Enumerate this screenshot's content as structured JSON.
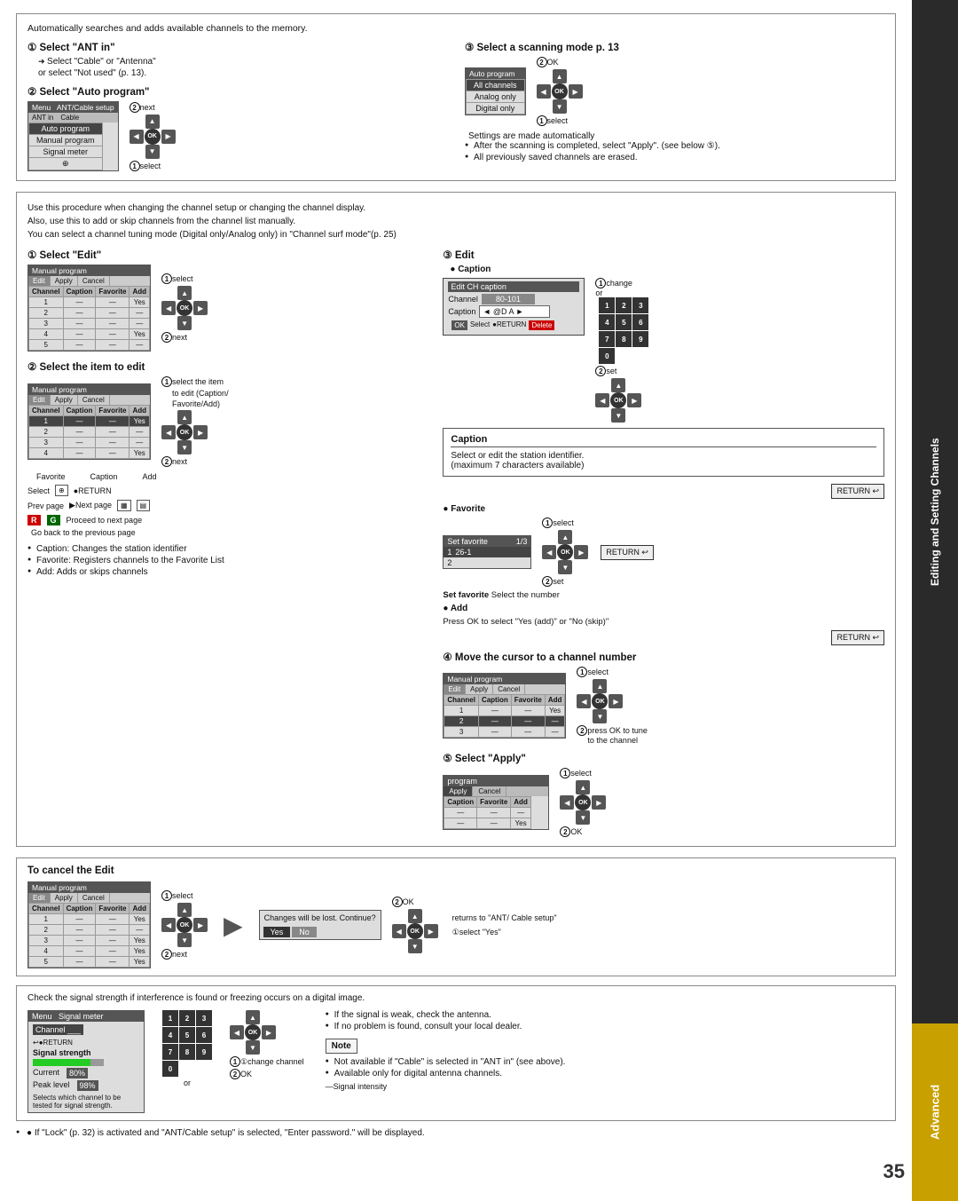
{
  "page": {
    "number": "35",
    "sidebar_editing": "Editing and Setting Channels",
    "sidebar_advanced": "Advanced"
  },
  "top_section": {
    "intro": "Automatically searches and adds available channels to the memory.",
    "step1_heading": "① Select \"ANT in\"",
    "step1_sub1": "Select \"Cable\" or \"Antenna\"",
    "step1_sub2": "or select \"Not used\" (p. 13).",
    "step2_heading": "② Select \"Auto program\"",
    "step3_heading": "③ Select a scanning mode p. 13",
    "note1": "After the scanning is completed, select \"Apply\".",
    "note2": "(see below ⑤).",
    "note3": "All previously saved channels are erased.",
    "settings_auto": "Settings are made automatically",
    "annotation_next": "②next",
    "annotation_select1": "①select",
    "annotation_ok": "②OK",
    "annotation_select2": "①select"
  },
  "menu_auto_program": {
    "header_col1": "Menu",
    "header_col2": "ANT/Cable setup",
    "header_sub1": "ANT in",
    "header_sub2": "Cable",
    "rows": [
      {
        "label": "Auto program",
        "highlight": true
      },
      {
        "label": "Manual program",
        "highlight": false
      },
      {
        "label": "Signal meter",
        "highlight": false
      }
    ]
  },
  "menu_auto_program2": {
    "header": "Auto program",
    "rows": [
      {
        "label": "All channels",
        "highlight": true
      },
      {
        "label": "Analog only",
        "highlight": false
      },
      {
        "label": "Digital only",
        "highlight": false
      }
    ]
  },
  "middle_section": {
    "intro_lines": [
      "Use this procedure when changing the channel setup or changing the channel display.",
      "Also, use this to add or skip channels from the channel list manually.",
      "You can select a channel tuning mode (Digital only/Analog only) in \"Channel surf mode\"(p. 25)"
    ],
    "step1_heading": "① Select \"Edit\"",
    "step2_heading": "② Select the item to edit",
    "step2_items": [
      "Caption: Changes the station identifier",
      "Favorite: Registers channels to the Favorite List",
      "Add: Adds or skips channels"
    ],
    "proceed_next_page": "Proceed to next page",
    "go_back": "Go back to the previous page",
    "step3_edit_heading": "③ Edit",
    "step3_caption_heading": "● Caption",
    "caption_desc": "Select or edit the station identifier.",
    "caption_max": "(maximum 7 characters available)",
    "step3_favorite_heading": "● Favorite",
    "step4_move_heading": "④ Move the cursor to a channel number",
    "step5_apply_heading": "⑤ Select \"Apply\"",
    "add_heading": "● Add",
    "add_desc": "Press OK to select \"Yes (add)\" or \"No (skip)\"",
    "set_favorite_label": "Set favorite",
    "set_favorite_desc": "Select the number",
    "annotations": {
      "select": "①select",
      "next": "②next",
      "change": "①change",
      "set": "②set",
      "ok": "②OK",
      "press_ok": "②press OK to tune to the channel"
    }
  },
  "cancel_section": {
    "heading": "To cancel the Edit",
    "annotations": {
      "select": "①select",
      "next": "②next",
      "ok": "②OK",
      "returns": "returns to \"ANT/ Cable setup\"",
      "select_yes": "①select \"Yes\""
    },
    "dialog": {
      "msg": "Changes will be lost. Continue?",
      "btn_yes": "Yes",
      "btn_no": "No"
    }
  },
  "signal_section": {
    "intro": "Check the signal strength if interference is found or freezing occurs on a digital image.",
    "note1": "If the signal is weak, check the antenna.",
    "note2": "If no problem is found, consult your local dealer.",
    "annotations": {
      "change_channel": "①change channel",
      "ok": "②OK"
    },
    "note_label": "Note",
    "note3": "Not available if \"Cable\" is selected in \"ANT in\" (see above).",
    "note4": "Available only for digital antenna channels.",
    "signal_intensity_label": "Signal intensity",
    "menu_signal": {
      "header": "Menu",
      "sub": "Signal meter",
      "channel_label": "Channel",
      "signal_strength_label": "Signal strength",
      "current_label": "Current",
      "current_value": "80%",
      "peak_label": "Peak level",
      "peak_value": "98%"
    }
  },
  "bottom_note": {
    "text": "● If \"Lock\" (p. 32) is activated and \"ANT/Cable setup\" is selected, \"Enter password.\" will be displayed."
  },
  "manual_program_sim": {
    "header": "Manual program",
    "tabs": [
      "Edit",
      "Apply",
      "Cancel"
    ],
    "col_headers": [
      "Channel",
      "Caption",
      "Favorite",
      "Add"
    ],
    "rows": [
      [
        "1",
        "—",
        "—",
        "Yes"
      ],
      [
        "2",
        "—",
        "—",
        "—"
      ],
      [
        "3",
        "—",
        "—",
        "—"
      ],
      [
        "4",
        "—",
        "—",
        "Yes"
      ],
      [
        "5",
        "—",
        "—",
        "—"
      ]
    ]
  },
  "caption_edit_sim": {
    "header": "Edit CH caption",
    "channel_label": "Channel",
    "channel_value": "80-101",
    "caption_label": "Caption",
    "caption_value": "◄ @D A ►"
  },
  "set_favorite_sim": {
    "header": "Set favorite",
    "fraction": "1/3",
    "rows": [
      {
        "num": "1",
        "val": "26-1",
        "highlight": true
      },
      {
        "num": "2",
        "val": "",
        "highlight": false
      }
    ]
  },
  "apply_sim": {
    "header": "program",
    "tabs": [
      "Apply",
      "Cancel"
    ],
    "col_headers": [
      "Caption",
      "Favorite",
      "Add"
    ],
    "rows": [
      {
        "vals": [
          "—",
          "—",
          "—"
        ]
      },
      {
        "vals": [
          "—",
          "—",
          "Yes"
        ]
      }
    ]
  },
  "icons": {
    "bullet": "●",
    "arrow_right": "▶",
    "arrow_left": "◀",
    "arrow_up": "▲",
    "arrow_down": "▼",
    "return_sym": "↩",
    "circle_arrow": "➜"
  }
}
